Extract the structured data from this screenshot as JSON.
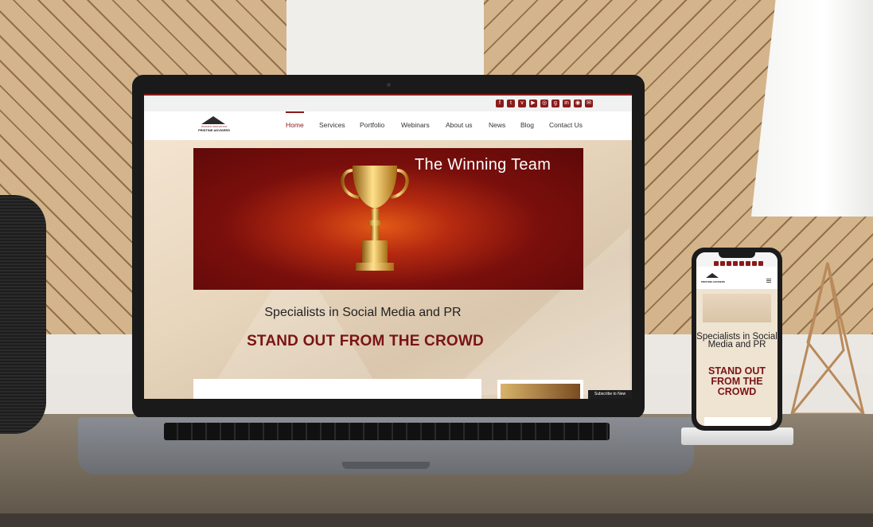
{
  "site": {
    "logo": {
      "tagline": "PASSION INNOVATION",
      "name": "PRISTINE ADVISERS"
    },
    "social_icons": [
      "f",
      "t",
      "v",
      "▶",
      "◎",
      "g",
      "in",
      "◉",
      "✉"
    ],
    "nav": {
      "items": [
        "Home",
        "Services",
        "Portfolio",
        "Webinars",
        "About us",
        "News",
        "Blog",
        "Contact Us"
      ],
      "active": "Home"
    },
    "banner": {
      "title": "The Winning Team"
    },
    "tagline": "Specialists in Social Media and PR",
    "headline": "STAND OUT FROM THE CROWD",
    "subscribe_button": "Subscribe to New"
  },
  "mobile": {
    "tagline": "Specialists in Social Media and PR",
    "headline": "STAND OUT FROM THE CROWD"
  },
  "colors": {
    "brand": "#8b1a1a",
    "headline": "#7a1414"
  }
}
